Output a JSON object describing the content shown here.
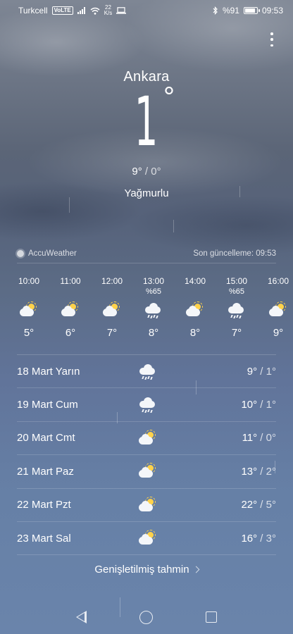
{
  "status_bar": {
    "carrier": "Turkcell",
    "volte": "VoLTE",
    "net_speed_value": "22",
    "net_speed_unit": "K/s",
    "battery_text": "%91",
    "battery_level": 0.91,
    "time": "09:53",
    "icons": [
      "signal-icon",
      "wifi-icon",
      "laptop-icon",
      "bluetooth-icon",
      "battery-icon"
    ]
  },
  "current": {
    "city": "Ankara",
    "temperature": "1",
    "degree_symbol": "°",
    "high": "9°",
    "low": "0°",
    "separator": " / ",
    "condition": "Yağmurlu"
  },
  "source": {
    "provider": "AccuWeather",
    "last_updated": "Son güncelleme: 09:53"
  },
  "hourly": [
    {
      "time": "10:00",
      "pop": "",
      "icon": "partly-sunny",
      "temp": "5°"
    },
    {
      "time": "11:00",
      "pop": "",
      "icon": "partly-sunny",
      "temp": "6°"
    },
    {
      "time": "12:00",
      "pop": "",
      "icon": "partly-sunny",
      "temp": "7°"
    },
    {
      "time": "13:00",
      "pop": "%65",
      "icon": "rain",
      "temp": "8°"
    },
    {
      "time": "14:00",
      "pop": "",
      "icon": "partly-sunny",
      "temp": "8°"
    },
    {
      "time": "15:00",
      "pop": "%65",
      "icon": "rain",
      "temp": "7°"
    },
    {
      "time": "16:00",
      "pop": "",
      "icon": "partly-sunny",
      "temp": "9°"
    }
  ],
  "daily": [
    {
      "day": "18 Mart Yarın",
      "icon": "rain",
      "high": "9°",
      "low": "1°"
    },
    {
      "day": "19 Mart Cum",
      "icon": "rain",
      "high": "10°",
      "low": "1°"
    },
    {
      "day": "20 Mart Cmt",
      "icon": "partly-sunny",
      "high": "11°",
      "low": "0°"
    },
    {
      "day": "21 Mart Paz",
      "icon": "partly-sunny",
      "high": "13°",
      "low": "2°"
    },
    {
      "day": "22 Mart Pzt",
      "icon": "partly-sunny",
      "high": "22°",
      "low": "5°"
    },
    {
      "day": "23 Mart Sal",
      "icon": "partly-sunny",
      "high": "16°",
      "low": "3°"
    }
  ],
  "extended_forecast_label": "Genişletilmiş tahmin",
  "colors": {
    "sun": "#ffd24a",
    "cloud": "#f4f6f9",
    "text": "#ffffff"
  }
}
